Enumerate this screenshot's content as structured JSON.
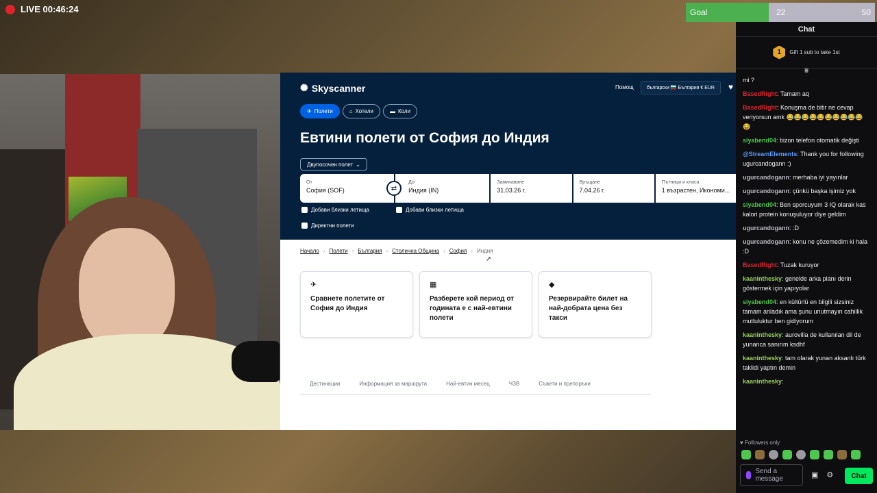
{
  "stream": {
    "live_label": "LIVE 00:46:24",
    "goal_label": "Goal",
    "goal_current": "22",
    "goal_max": "50",
    "goal_progress": 0.44
  },
  "browser": {
    "logo": "Skyscanner",
    "help": "Помощ",
    "locale": "български 🇧🇬 България € EUR",
    "tabs": [
      {
        "label": "Полети",
        "icon": "plane-icon"
      },
      {
        "label": "Хотели",
        "icon": "bed-icon"
      },
      {
        "label": "Коли",
        "icon": "car-icon"
      }
    ],
    "heading": "Евтини полети от София до Индия",
    "trip_type": "Двупосочен полет",
    "search": {
      "from_label": "От",
      "from_value": "София (SOF)",
      "to_label": "До",
      "to_value": "Индия (IN)",
      "depart_label": "Заминаване",
      "depart_value": "31.03.26 г.",
      "return_label": "Връщане",
      "return_value": "7.04.26 г.",
      "pax_label": "Пътници и класа",
      "pax_value": "1 възрастен, Икономи..."
    },
    "checkboxes": {
      "nearby_from": "Добави близки летища",
      "nearby_to": "Добави близки летища",
      "direct": "Директни полети"
    },
    "breadcrumbs": [
      "Начало",
      "Полети",
      "България",
      "Столична Община",
      "София",
      "Индия"
    ],
    "cards": [
      {
        "icon": "plane-icon",
        "text": "Сравнете полетите от София до Индия"
      },
      {
        "icon": "calendar-icon",
        "text": "Разберете кой период от годината е с най-евтини полети"
      },
      {
        "icon": "tag-icon",
        "text": "Резервирайте билет на най-добрата цена без такси"
      }
    ],
    "subnav": [
      "Дестинации",
      "Информация за маршрута",
      "Най-евтин месец",
      "ЧЗВ",
      "Съвети и препоръки"
    ]
  },
  "chat": {
    "title": "Chat",
    "gift_rank": "1",
    "gift_text": "Gift 1 sub to take 1st",
    "messages": [
      {
        "user": "",
        "text": "mi ?",
        "color": "#efeff1"
      },
      {
        "user": "BasedRight",
        "text": ": Tamam aq",
        "color": "#e0242d"
      },
      {
        "user": "BasedRight",
        "text": ": Konuşma de bitir ne cevap veriyorsun amk 😂😂😂😂😂😂😂😂😂😂😂",
        "color": "#e0242d"
      },
      {
        "user": "siyabend04",
        "text": ": bizon telefon otomatik değişti",
        "color": "#4dc74d"
      },
      {
        "user": "@StreamElements",
        "text": ": Thank you for following ugurcandogann :)",
        "color": "#5b9cff"
      },
      {
        "user": "ugurcandogann",
        "text": ": merhaba iyi yayınlar",
        "color": "#b8b8c0"
      },
      {
        "user": "ugurcandogann",
        "text": ": çünkü başka işimiz yok",
        "color": "#b8b8c0"
      },
      {
        "user": "siyabend04",
        "text": ": Ben sporcuyum 3 IQ olarak kas kalori protein konuşuluyor diye geldim",
        "color": "#4dc74d"
      },
      {
        "user": "ugurcandogann",
        "text": ": :D",
        "color": "#b8b8c0"
      },
      {
        "user": "ugurcandogann",
        "text": ": konu ne çözemedim ki hala :D",
        "color": "#b8b8c0"
      },
      {
        "user": "BasedRight",
        "text": ": Tuzak kuruyor",
        "color": "#e0242d"
      },
      {
        "user": "kaaninthesky",
        "text": ": genelde arka planı derin göstermek için yapıyolar",
        "color": "#9ad05a"
      },
      {
        "user": "siyabend04",
        "text": ": en kültürlü en bilgili sizsiniz tamam anladık ama şunu unutmayın cahillik mutluluktur ben gidiyorum",
        "color": "#4dc74d"
      },
      {
        "user": "kaaninthesky",
        "text": ": aurovilla de kullanılan dil de yunanca sanırım ksdhf",
        "color": "#9ad05a"
      },
      {
        "user": "kaaninthesky",
        "text": ": tam olarak yunan aksanlı türk taklidi yaptın demin",
        "color": "#9ad05a"
      },
      {
        "user": "kaaninthesky",
        "text": ":",
        "color": "#9ad05a"
      }
    ],
    "followers_only": "♥ Followers only",
    "input_placeholder": "Send a message",
    "send_label": "Chat"
  }
}
